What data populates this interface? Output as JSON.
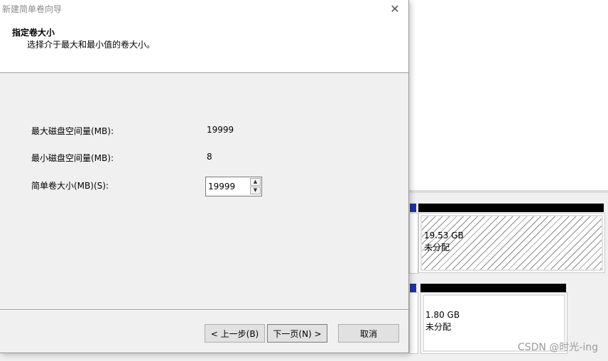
{
  "wizard": {
    "title": "新建简单卷向导",
    "close_glyph": "✕",
    "header_title": "指定卷大小",
    "header_subtitle": "选择介于最大和最小值的卷大小。",
    "fields": {
      "max_label": "最大磁盘空间量(MB):",
      "max_value": "19999",
      "min_label": "最小磁盘空间量(MB):",
      "min_value": "8",
      "size_label": "简单卷大小(MB)(S):",
      "size_value": "19999"
    },
    "buttons": {
      "back": "< 上一步(B)",
      "next": "下一页(N) >",
      "cancel": "取消"
    }
  },
  "disk_mgmt": {
    "partitions": [
      {
        "size": "19.53 GB",
        "status": "未分配"
      },
      {
        "size": "1.80 GB",
        "status": "未分配"
      }
    ]
  },
  "watermark": "CSDN @时光-ing",
  "colors": {
    "disk_header": "#000000",
    "primary_strip": "#1e32a8",
    "dialog_bg": "#f0f0f0"
  }
}
